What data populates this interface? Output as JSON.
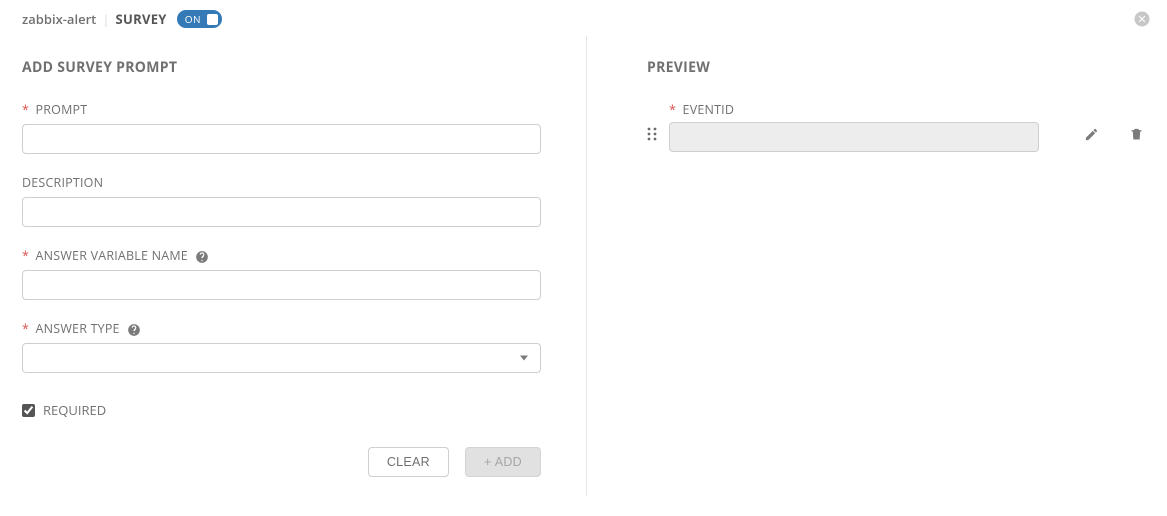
{
  "header": {
    "alert_name": "zabbix-alert",
    "tab_name": "SURVEY",
    "toggle_label": "ON"
  },
  "left": {
    "section_title": "ADD SURVEY PROMPT",
    "prompt": {
      "label": "PROMPT",
      "value": ""
    },
    "description": {
      "label": "DESCRIPTION",
      "value": ""
    },
    "answer_var": {
      "label": "ANSWER VARIABLE NAME",
      "value": ""
    },
    "answer_type": {
      "label": "ANSWER TYPE",
      "value": ""
    },
    "required": {
      "label": "REQUIRED",
      "checked": true
    },
    "buttons": {
      "clear": "CLEAR",
      "add": "+ ADD"
    }
  },
  "right": {
    "section_title": "PREVIEW",
    "items": [
      {
        "label": "EVENTID",
        "value": ""
      }
    ]
  }
}
